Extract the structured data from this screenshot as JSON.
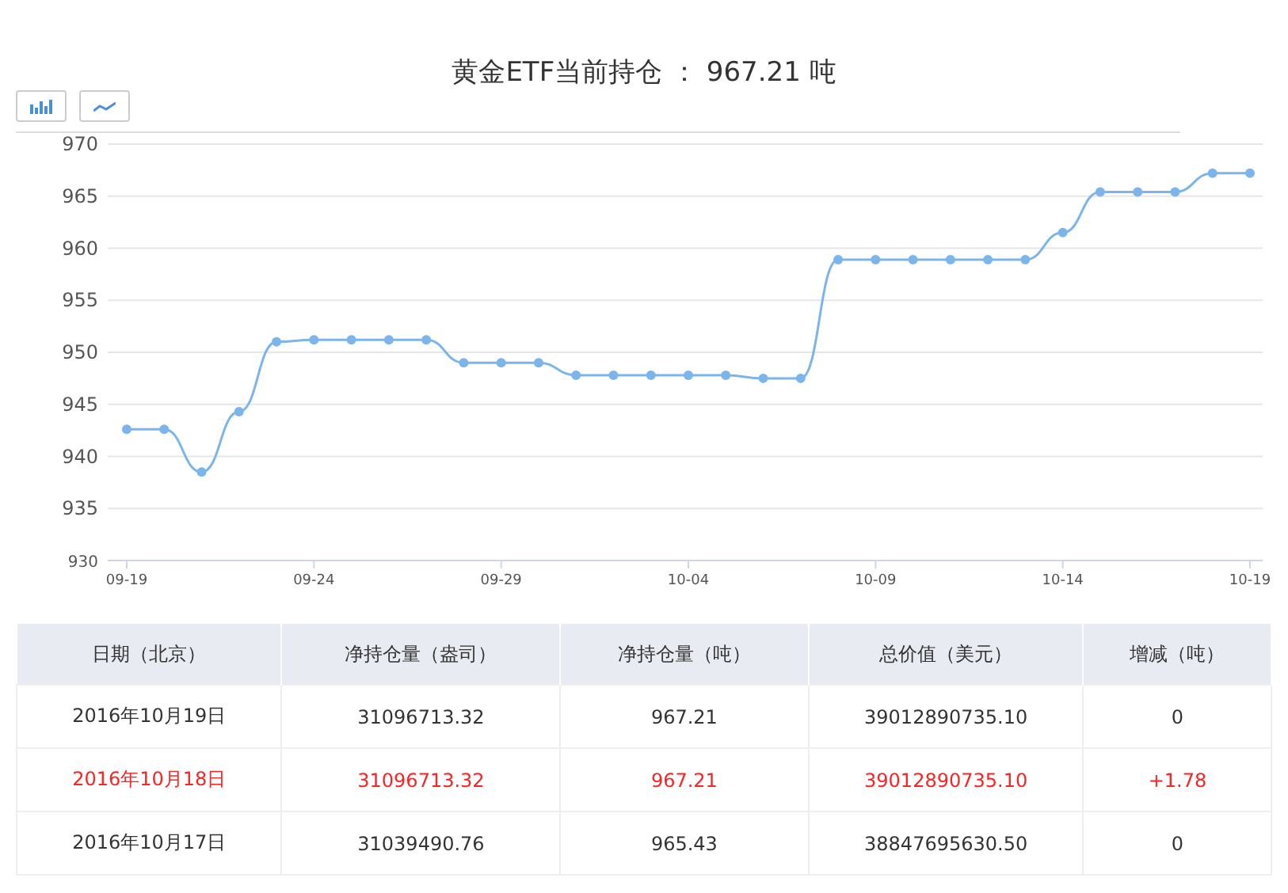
{
  "title": "黄金ETF当前持仓 ： 967.21 吨",
  "chart_buttons": [
    {
      "kind": "bar",
      "selected": false
    },
    {
      "kind": "line",
      "selected": false
    }
  ],
  "chart_data": {
    "type": "line",
    "categories": [
      "09-19",
      null,
      null,
      null,
      null,
      "09-24",
      null,
      null,
      null,
      null,
      "09-29",
      null,
      null,
      null,
      null,
      "10-04",
      null,
      null,
      null,
      null,
      "10-09",
      null,
      null,
      null,
      null,
      "10-14",
      null,
      null,
      null,
      null,
      "10-19"
    ],
    "series": [
      {
        "color": "#7cb5ec",
        "marker": true,
        "values": [
          942.6,
          942.6,
          938.5,
          944.3,
          951.0,
          951.2,
          951.2,
          951.2,
          951.2,
          949.0,
          949.0,
          949.0,
          947.8,
          947.8,
          947.8,
          947.8,
          947.8,
          947.5,
          947.5,
          958.9,
          958.9,
          958.9,
          958.9,
          958.9,
          958.9,
          961.5,
          965.4,
          965.4,
          965.4,
          967.2,
          967.2
        ]
      }
    ],
    "grid": true,
    "ylim": [
      930,
      970
    ],
    "yticks": [
      930,
      935,
      940,
      945,
      950,
      955,
      960,
      965,
      970
    ]
  },
  "table": {
    "columns": [
      "日期（北京）",
      "净持仓量（盎司）",
      "净持仓量（吨）",
      "总价值（美元）",
      "增减（吨）"
    ],
    "rows": [
      {
        "highlight": false,
        "cells": [
          "2016年10月19日",
          "31096713.32",
          "967.21",
          "39012890735.10",
          "0"
        ]
      },
      {
        "highlight": true,
        "cells": [
          "2016年10月18日",
          "31096713.32",
          "967.21",
          "39012890735.10",
          "+1.78"
        ]
      },
      {
        "highlight": false,
        "cells": [
          "2016年10月17日",
          "31039490.76",
          "965.43",
          "38847695630.50",
          "0"
        ]
      }
    ]
  }
}
